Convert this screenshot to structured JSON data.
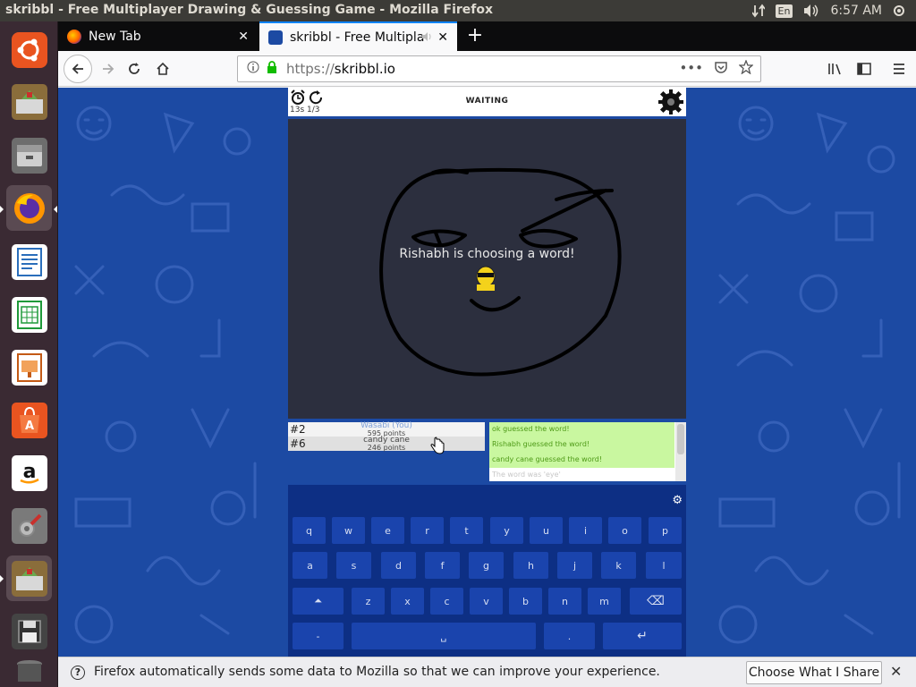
{
  "top_panel": {
    "window_title": "skribbl - Free Multiplayer Drawing & Guessing Game - Mozilla Firefox",
    "keyboard_layout": "En",
    "clock": "6:57 AM"
  },
  "launcher": {
    "items": [
      "ubuntu-home",
      "system-installer",
      "files",
      "firefox",
      "libreoffice-writer",
      "libreoffice-calc",
      "libreoffice-impress",
      "ubuntu-software",
      "amazon",
      "system-settings",
      "installer-2",
      "save-floppy",
      "trash"
    ]
  },
  "browser": {
    "tabs": [
      {
        "label": "New Tab",
        "close": "✕"
      },
      {
        "label": "skribbl - Free Multipla",
        "close": "✕"
      }
    ],
    "new_tab_symbol": "+",
    "url_scheme": "https://",
    "url_host": "skribbl.io",
    "url_more": "•••"
  },
  "game": {
    "round_info": "13s 1/3",
    "status": "WAITING",
    "overlay_message": "Rishabh is choosing a word!",
    "players": [
      {
        "rank": "#2",
        "name": "Wasabi (You)",
        "points": "595 points"
      },
      {
        "rank": "#6",
        "name": "candy cane",
        "points": "246 points"
      }
    ],
    "chat": [
      {
        "text": "ok guessed the word!",
        "style": "green"
      },
      {
        "text": "Rishabh guessed the word!",
        "style": "green"
      },
      {
        "text": "candy cane guessed the word!",
        "style": "green"
      },
      {
        "text": "The word was 'eye'",
        "style": "plain"
      }
    ],
    "keyboard": {
      "row1": [
        "q",
        "w",
        "e",
        "r",
        "t",
        "y",
        "u",
        "i",
        "o",
        "p"
      ],
      "row2": [
        "a",
        "s",
        "d",
        "f",
        "g",
        "h",
        "j",
        "k",
        "l"
      ],
      "row3": [
        "⏶",
        "z",
        "x",
        "c",
        "v",
        "b",
        "n",
        "m",
        "⌫"
      ],
      "row4": [
        "-",
        "␣",
        ".",
        "↵"
      ]
    }
  },
  "notification": {
    "message": "Firefox automatically sends some data to Mozilla so that we can improve your experience.",
    "button": "Choose What I Share",
    "close": "✕",
    "icon": "?"
  },
  "colors": {
    "page_bg": "#1c4aa3",
    "canvas_bg": "#2c2f3e",
    "keyboard_bg": "#0d2f84",
    "key_bg": "#1a44ad",
    "chat_green": "#c9f7a0",
    "firefox_accent": "#0a84ff"
  }
}
